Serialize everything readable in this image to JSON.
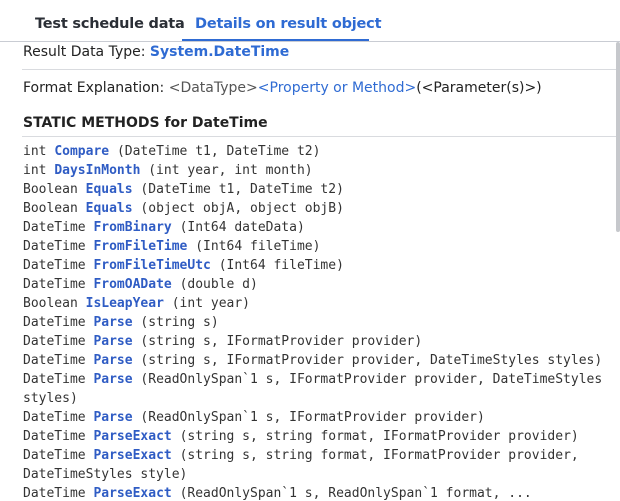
{
  "tabs": [
    {
      "label": "Test schedule data",
      "active": false
    },
    {
      "label": "Details on result object",
      "active": true
    }
  ],
  "result": {
    "label": "Result Data Type: ",
    "type": "System.DateTime"
  },
  "format": {
    "label": "Format Explanation: ",
    "datatype": "<DataType>",
    "property": "<Property or Method>",
    "params": "(<Parameter(s)>)"
  },
  "section_title": "STATIC METHODS for DateTime",
  "methods": [
    {
      "ret": "int",
      "name": "Compare",
      "args": "(DateTime t1, DateTime t2)"
    },
    {
      "ret": "int",
      "name": "DaysInMonth",
      "args": "(int year, int month)"
    },
    {
      "ret": "Boolean",
      "name": "Equals",
      "args": "(DateTime t1, DateTime t2)"
    },
    {
      "ret": "Boolean",
      "name": "Equals",
      "args": "(object objA, object objB)"
    },
    {
      "ret": "DateTime",
      "name": "FromBinary",
      "args": "(Int64 dateData)"
    },
    {
      "ret": "DateTime",
      "name": "FromFileTime",
      "args": "(Int64 fileTime)"
    },
    {
      "ret": "DateTime",
      "name": "FromFileTimeUtc",
      "args": "(Int64 fileTime)"
    },
    {
      "ret": "DateTime",
      "name": "FromOADate",
      "args": "(double d)"
    },
    {
      "ret": "Boolean",
      "name": "IsLeapYear",
      "args": "(int year)"
    },
    {
      "ret": "DateTime",
      "name": "Parse",
      "args": "(string s)"
    },
    {
      "ret": "DateTime",
      "name": "Parse",
      "args": "(string s, IFormatProvider provider)"
    },
    {
      "ret": "DateTime",
      "name": "Parse",
      "args": "(string s, IFormatProvider provider, DateTimeStyles styles)"
    },
    {
      "ret": "DateTime",
      "name": "Parse",
      "args": "(ReadOnlySpan`1 s, IFormatProvider provider, DateTimeStyles styles)"
    },
    {
      "ret": "DateTime",
      "name": "Parse",
      "args": "(ReadOnlySpan`1 s, IFormatProvider provider)"
    },
    {
      "ret": "DateTime",
      "name": "ParseExact",
      "args": "(string s, string format, IFormatProvider provider)"
    },
    {
      "ret": "DateTime",
      "name": "ParseExact",
      "args": "(string s, string format, IFormatProvider provider, DateTimeStyles style)"
    },
    {
      "ret": "DateTime",
      "name": "ParseExact",
      "args": "(ReadOnlySpan`1 s, ReadOnlySpan`1 format, ..."
    }
  ]
}
